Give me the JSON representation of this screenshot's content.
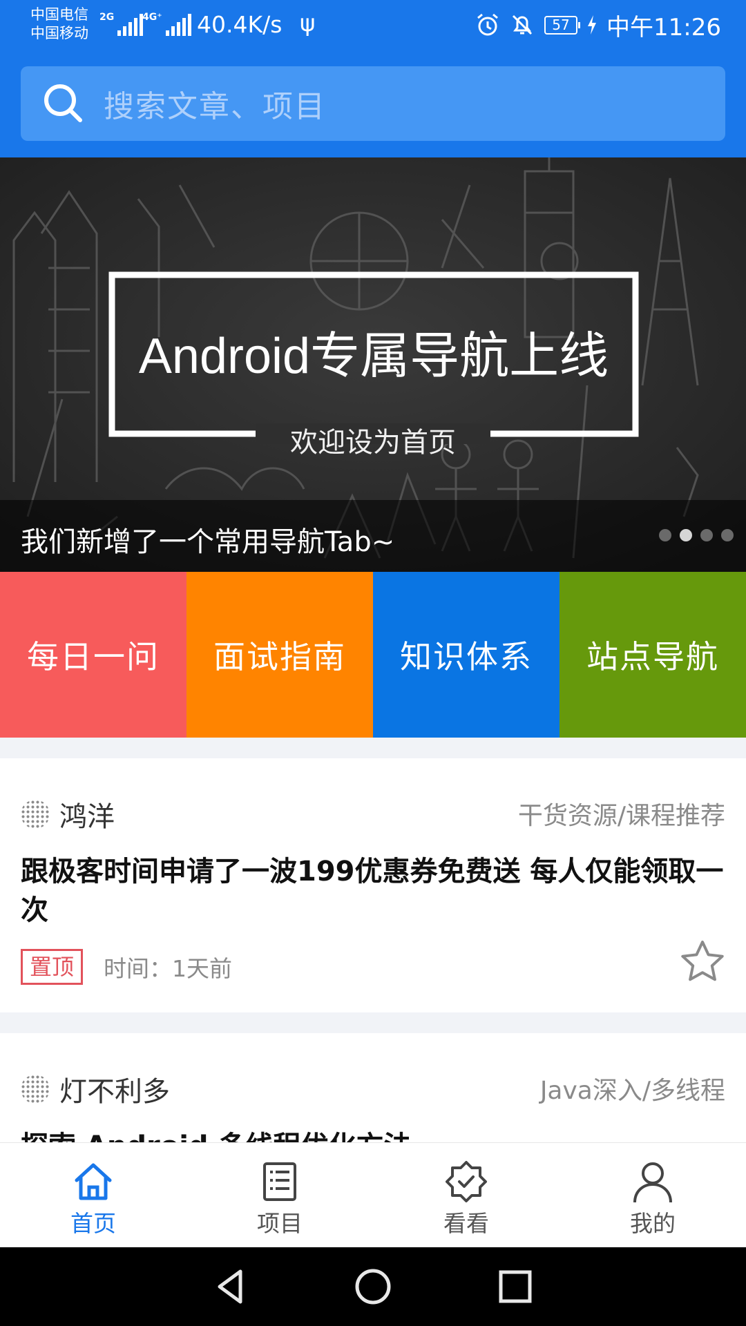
{
  "status_bar": {
    "carrier_1": "中国电信",
    "carrier_2": "中国移动",
    "net_1": "2G",
    "net_2": "4G⁺",
    "speed": "40.4K/s",
    "battery": "57",
    "time": "中午11:26"
  },
  "search": {
    "placeholder": "搜索文章、项目"
  },
  "banner": {
    "headline": "Android专属导航上线",
    "subline": "欢迎设为首页",
    "caption": "我们新增了一个常用导航Tab~",
    "page_count": 4,
    "active_index": 1
  },
  "tiles": [
    {
      "label": "每日一问",
      "color": "#f75b5b"
    },
    {
      "label": "面试指南",
      "color": "#ff8400"
    },
    {
      "label": "知识体系",
      "color": "#0a75e3"
    },
    {
      "label": "站点导航",
      "color": "#66990c"
    }
  ],
  "articles": [
    {
      "author": "鸿洋",
      "category": "干货资源/课程推荐",
      "title": "跟极客时间申请了一波199优惠券免费送 每人仅能领取一次",
      "tag": "置顶",
      "time": "时间：1天前"
    },
    {
      "author": "灯不利多",
      "category": "Java深入/多线程",
      "title": "探索 Android 多线程优化方法"
    }
  ],
  "bottom_nav": [
    {
      "label": "首页",
      "icon": "home-icon",
      "active": true
    },
    {
      "label": "项目",
      "icon": "list-icon",
      "active": false
    },
    {
      "label": "看看",
      "icon": "verified-icon",
      "active": false
    },
    {
      "label": "我的",
      "icon": "person-icon",
      "active": false
    }
  ],
  "colors": {
    "primary": "#1977ea",
    "search_field": "#4597f4",
    "pin_tag": "#e2525b"
  }
}
